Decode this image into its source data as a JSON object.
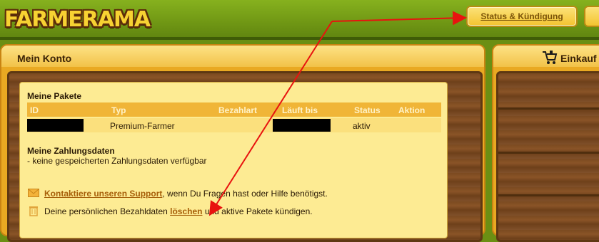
{
  "header": {
    "logo_text": "FARMERAMA",
    "status_button_label": "Status & Kündigung"
  },
  "account_panel": {
    "title": "Mein Konto",
    "packages": {
      "title": "Meine Pakete",
      "columns": [
        "ID",
        "Typ",
        "Bezahlart",
        "Läuft bis",
        "Status",
        "Aktion"
      ],
      "rows": [
        {
          "id": "",
          "typ": "Premium-Farmer",
          "bezahlart": "",
          "laeuft_bis": "",
          "status": "aktiv",
          "aktion": ""
        }
      ]
    },
    "payment": {
      "title": "Meine Zahlungsdaten",
      "text": "- keine gespeicherten Zahlungsdaten verfügbar"
    },
    "support_line": {
      "link": "Kontaktiere unseren Support",
      "text": ", wenn Du Fragen hast oder Hilfe benötigst."
    },
    "delete_line": {
      "text_before": "Deine persönlichen Bezahldaten ",
      "link": "löschen",
      "text_after": " und aktive Pakete kündigen."
    }
  },
  "shop_panel": {
    "title": "Einkauf"
  },
  "annotation": {
    "color": "#e8130f"
  }
}
